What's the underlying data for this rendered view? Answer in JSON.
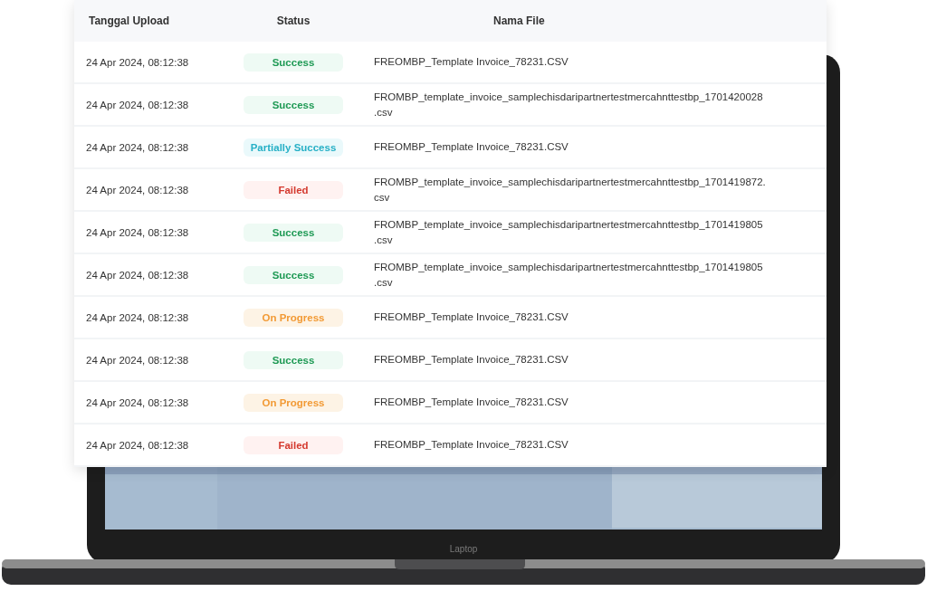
{
  "table": {
    "columns": [
      "Tanggal Upload",
      "Status",
      "Nama File"
    ],
    "rows": [
      {
        "date": "24 Apr 2024, 08:12:38",
        "status": "Success",
        "kind": "success",
        "file": "FREOMBP_Template Invoice_78231.CSV"
      },
      {
        "date": "24 Apr 2024, 08:12:38",
        "status": "Success",
        "kind": "success",
        "file": "FROMBP_template_invoice_samplechisdaripartnertestmercahnttestbp_1701420028\n.csv"
      },
      {
        "date": "24 Apr 2024, 08:12:38",
        "status": "Partially Success",
        "kind": "partial",
        "file": "FREOMBP_Template Invoice_78231.CSV"
      },
      {
        "date": "24 Apr 2024, 08:12:38",
        "status": "Failed",
        "kind": "failed",
        "file": "FROMBP_template_invoice_samplechisdaripartnertestmercahnttestbp_1701419872.\ncsv"
      },
      {
        "date": "24 Apr 2024, 08:12:38",
        "status": "Success",
        "kind": "success",
        "file": "FROMBP_template_invoice_samplechisdaripartnertestmercahnttestbp_1701419805\n.csv"
      },
      {
        "date": "24 Apr 2024, 08:12:38",
        "status": "Success",
        "kind": "success",
        "file": "FROMBP_template_invoice_samplechisdaripartnertestmercahnttestbp_1701419805\n.csv"
      },
      {
        "date": "24 Apr 2024, 08:12:38",
        "status": "On Progress",
        "kind": "progress",
        "file": "FREOMBP_Template Invoice_78231.CSV"
      },
      {
        "date": "24 Apr 2024, 08:12:38",
        "status": "Success",
        "kind": "success",
        "file": "FREOMBP_Template Invoice_78231.CSV"
      },
      {
        "date": "24 Apr 2024, 08:12:38",
        "status": "On Progress",
        "kind": "progress",
        "file": "FREOMBP_Template Invoice_78231.CSV"
      },
      {
        "date": "24 Apr 2024, 08:12:38",
        "status": "Failed",
        "kind": "failed",
        "file": "FREOMBP_Template Invoice_78231.CSV"
      }
    ]
  },
  "laptop": {
    "label": "Laptop"
  }
}
